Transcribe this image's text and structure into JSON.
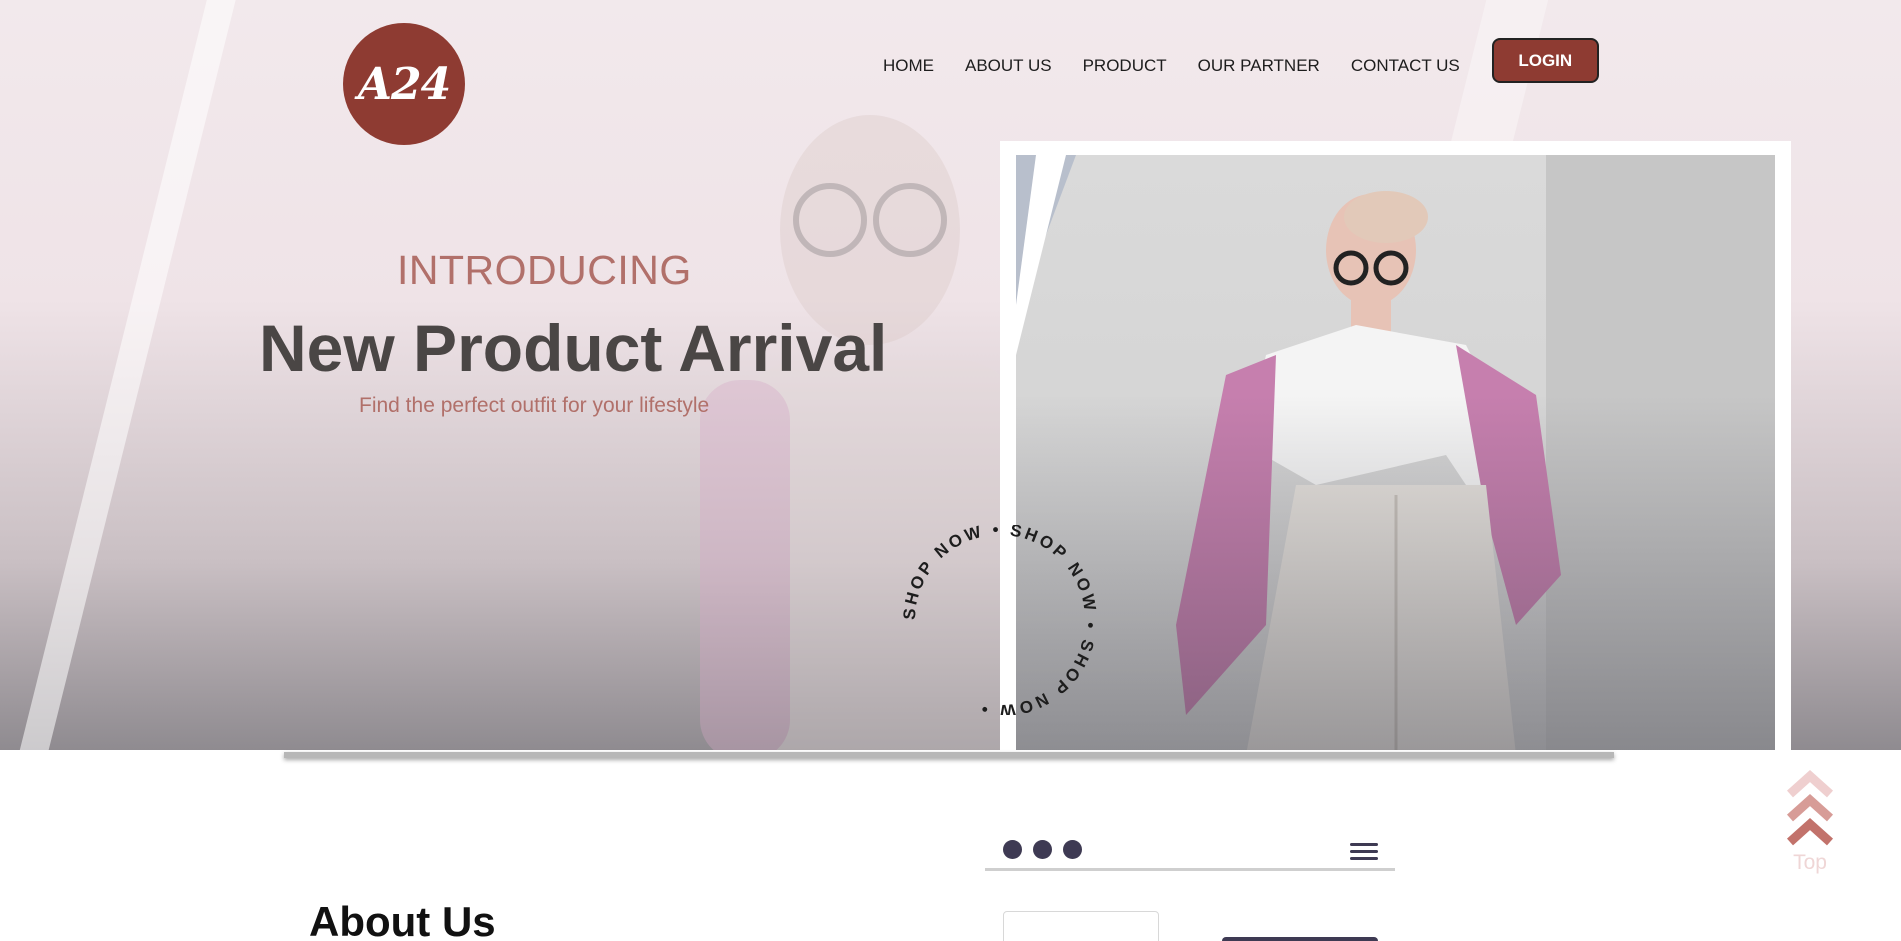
{
  "logo": {
    "text": "A24"
  },
  "nav": {
    "items": [
      "HOME",
      "ABOUT US",
      "PRODUCT",
      "OUR PARTNER",
      "CONTACT US"
    ],
    "login_label": "LOGIN"
  },
  "hero": {
    "kicker": "INTRODUCING",
    "headline": "New Product Arrival",
    "subline": "Find the perfect outfit for your lifestyle",
    "badge_text": "SHOP NOW • SHOP NOW • SHOP NOW • "
  },
  "about": {
    "title": "About Us"
  },
  "back_to_top": {
    "label": "Top"
  },
  "colors": {
    "brand": "#8e3b32",
    "accent_text": "#b1706a",
    "headline": "#4a4645",
    "mock_dark": "#3e3a53"
  }
}
